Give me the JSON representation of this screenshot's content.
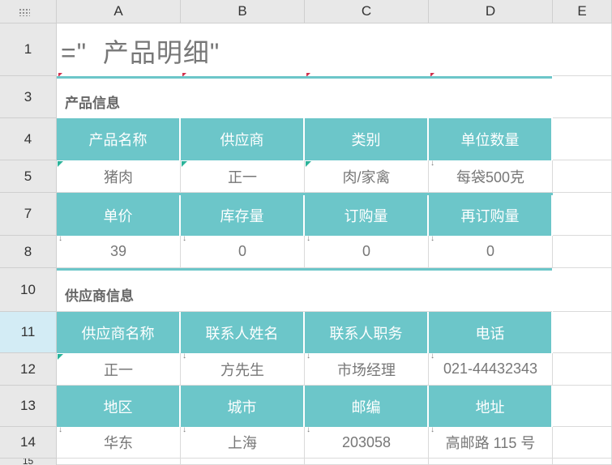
{
  "columns": [
    "A",
    "B",
    "C",
    "D",
    "E"
  ],
  "rows": [
    "1",
    "3",
    "4",
    "5",
    "7",
    "8",
    "10",
    "11",
    "12",
    "13",
    "14",
    "15"
  ],
  "title": "=\"  产品明细\"",
  "sections": {
    "product": "产品信息",
    "supplier": "供应商信息"
  },
  "product_headers_1": [
    "产品名称",
    "供应商",
    "类别",
    "单位数量"
  ],
  "product_values_1": [
    "猪肉",
    "正一",
    "肉/家禽",
    "每袋500克"
  ],
  "product_headers_2": [
    "单价",
    "库存量",
    "订购量",
    "再订购量"
  ],
  "product_values_2": [
    "39",
    "0",
    "0",
    "0"
  ],
  "supplier_headers_1": [
    "供应商名称",
    "联系人姓名",
    "联系人职务",
    "电话"
  ],
  "supplier_values_1": [
    "正一",
    "方先生",
    "市场经理",
    "021-44432343"
  ],
  "supplier_headers_2": [
    "地区",
    "城市",
    "邮编",
    "地址"
  ],
  "supplier_values_2": [
    "华东",
    "上海",
    "203058",
    "高邮路 115 号"
  ],
  "colors": {
    "accent": "#6cc6c9",
    "header_bg": "#e8e8e8",
    "selected_row": "#d3ecf5"
  }
}
